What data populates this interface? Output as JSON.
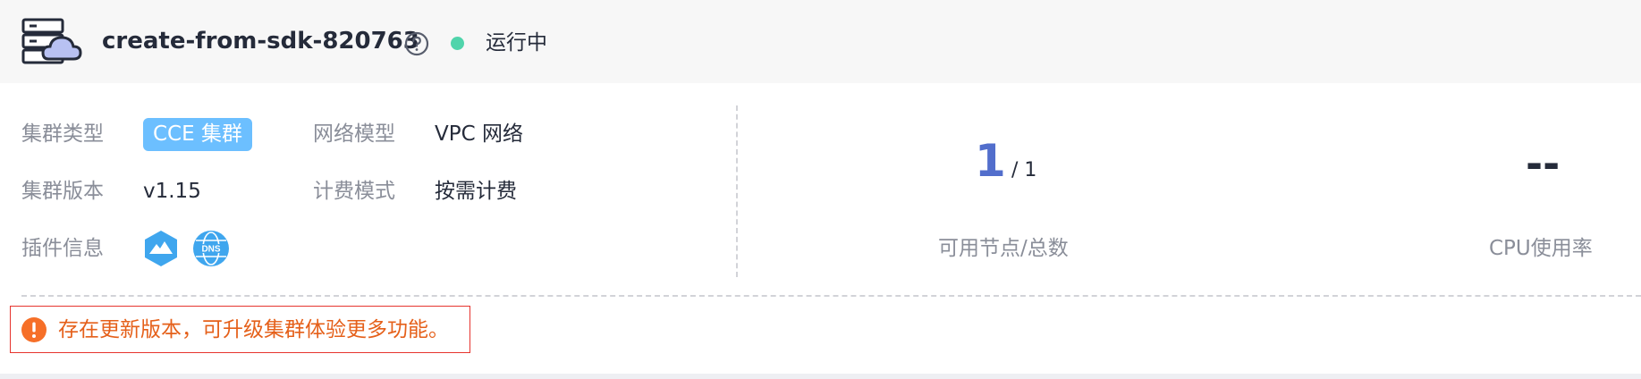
{
  "header": {
    "cluster_icon": "server-cloud-icon",
    "cluster_name": "create-from-sdk-820763",
    "help_icon": "question-circle-icon",
    "status": {
      "text": "运行中",
      "color": "#50d4ab"
    }
  },
  "info": {
    "cluster_type": {
      "label": "集群类型",
      "value": "CCE 集群"
    },
    "network_model": {
      "label": "网络模型",
      "value": "VPC 网络"
    },
    "cluster_version": {
      "label": "集群版本",
      "value": "v1.15"
    },
    "billing_mode": {
      "label": "计费模式",
      "value": "按需计费"
    },
    "addons": {
      "label": "插件信息",
      "icons": [
        "mountain-addon-icon",
        "dns-addon-icon"
      ],
      "dns_text": "DNS"
    }
  },
  "stats": {
    "nodes": {
      "available": "1",
      "total": "/ 1",
      "label": "可用节点/总数"
    },
    "cpu": {
      "value": "--",
      "label": "CPU使用率"
    }
  },
  "alert": {
    "icon": "exclamation-circle-icon",
    "text": "存在更新版本，可升级集群体验更多功能。"
  },
  "colors": {
    "accent_blue": "#526ecc",
    "tag_blue": "#6cbfff",
    "warning_orange": "#e5601a",
    "alert_border": "#e6342e"
  }
}
